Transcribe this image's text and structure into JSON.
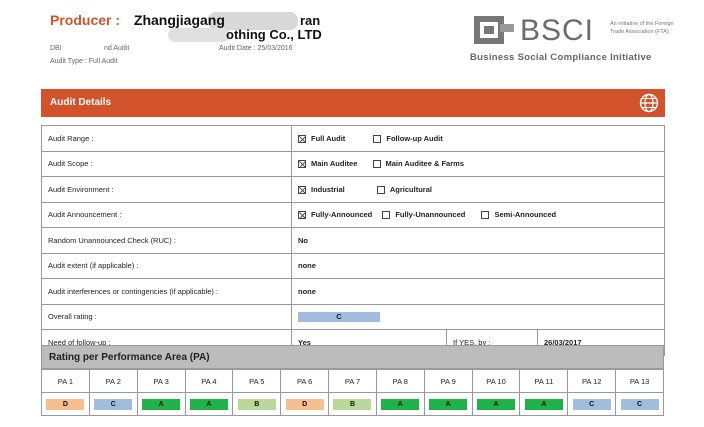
{
  "header": {
    "producer_label": "Producer :",
    "producer_name": "Zhangjiagang",
    "producer_name_tail": "ran",
    "producer_line2": "othing Co., LTD",
    "dbid_text": "DBI",
    "audit_kind_text": "nd Audit",
    "audit_date": "Audit Date : 25/03/2016",
    "audit_type": "Audit Type : Full Audit"
  },
  "logo": {
    "wordmark": "BSCI",
    "tagline": "An initiative of the Foreign Trade Association (FTA)",
    "subtitle": "Business Social Compliance Initiative"
  },
  "section": {
    "title": "Audit Details",
    "icon": "globe-icon"
  },
  "details": {
    "audit_range": {
      "label": "Audit Range :",
      "opt1": "Full Audit",
      "opt2": "Follow-up Audit"
    },
    "audit_scope": {
      "label": "Audit Scope :",
      "opt1": "Main Auditee",
      "opt2": "Main Auditee & Farms"
    },
    "audit_environment": {
      "label": "Audit Environment :",
      "opt1": "Industrial",
      "opt2": "Agricultural"
    },
    "audit_announcement": {
      "label": "Audit Announcement :",
      "opt1": "Fully-Announced",
      "opt2": "Fully-Unannounced",
      "opt3": "Semi-Announced"
    },
    "ruc": {
      "label": "Random Unannounced Check (RUC) :",
      "value": "No"
    },
    "extent": {
      "label": "Audit extent (if applicable) :",
      "value": "none"
    },
    "interferences": {
      "label": "Audit interferences or contingencies (if applicable) :",
      "value": "none"
    },
    "overall": {
      "label": "Overall rating :",
      "value": "C"
    },
    "followup": {
      "label": "Need of follow-up :",
      "value": "Yes",
      "ifyes_label": "If YES, by :",
      "ifyes_value": "26/03/2017"
    }
  },
  "performance": {
    "title": "Rating per Performance Area (PA)",
    "areas": [
      "PA 1",
      "PA 2",
      "PA 3",
      "PA 4",
      "PA 5",
      "PA 6",
      "PA 7",
      "PA 8",
      "PA 9",
      "PA 10",
      "PA 11",
      "PA 12",
      "PA 13"
    ],
    "ratings": [
      "D",
      "C",
      "A",
      "A",
      "B",
      "D",
      "B",
      "A",
      "A",
      "A",
      "A",
      "C",
      "C"
    ]
  },
  "colors": {
    "accent": "#d2532b",
    "A": "#1fb24b",
    "B": "#b9d89a",
    "C": "#a2bcde",
    "D": "#f6bf8f"
  }
}
